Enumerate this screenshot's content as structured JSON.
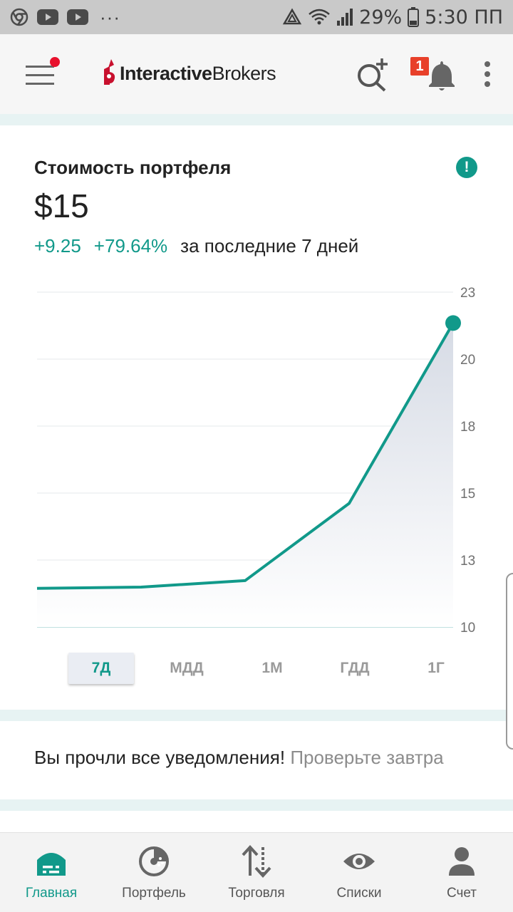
{
  "status_bar": {
    "battery": "29%",
    "time": "5:30 ПП",
    "overflow": "···",
    "icons": [
      "chrome-icon",
      "youtube-icon",
      "youtube-icon",
      "recycle-icon",
      "wifi-icon",
      "signal-icon",
      "battery-icon"
    ]
  },
  "header": {
    "logo_bold": "Interactive",
    "logo_thin": "Brokers",
    "notifications_count": "1",
    "has_menu_alert": true,
    "icons": [
      "menu-icon",
      "search-add-icon",
      "bell-icon",
      "more-vert-icon"
    ]
  },
  "portfolio": {
    "title": "Стоимость портфеля",
    "info_icon": "!",
    "value": "$15",
    "change_abs": "+9.25",
    "change_pct": "+79.64%",
    "period_text": "за последние 7 дней"
  },
  "chart_data": {
    "type": "area",
    "title": "",
    "xlabel": "",
    "ylabel": "",
    "x": [
      1,
      2,
      3,
      4,
      5
    ],
    "values": [
      11.5,
      11.55,
      11.8,
      14.8,
      21.8
    ],
    "ylim": [
      10,
      23
    ],
    "ytick_labels": [
      "23",
      "20",
      "18",
      "15",
      "13",
      "10"
    ],
    "grid": true,
    "line_color": "#11998a",
    "last_point_marker": true
  },
  "period_tabs": [
    {
      "label": "7Д",
      "active": true
    },
    {
      "label": "МДД",
      "active": false
    },
    {
      "label": "1М",
      "active": false
    },
    {
      "label": "ГДД",
      "active": false
    },
    {
      "label": "1Г",
      "active": false
    }
  ],
  "notification": {
    "main": "Вы прочли все уведомления!",
    "later": "Проверьте завтра"
  },
  "bottom_nav": [
    {
      "label": "Главная",
      "icon": "home-icon",
      "active": true
    },
    {
      "label": "Портфель",
      "icon": "portfolio-icon",
      "active": false
    },
    {
      "label": "Торговля",
      "icon": "trade-icon",
      "active": false
    },
    {
      "label": "Списки",
      "icon": "eye-icon",
      "active": false
    },
    {
      "label": "Счет",
      "icon": "account-icon",
      "active": false
    }
  ],
  "colors": {
    "accent": "#11998a",
    "alert": "#e8112d",
    "badge": "#e8402a"
  }
}
